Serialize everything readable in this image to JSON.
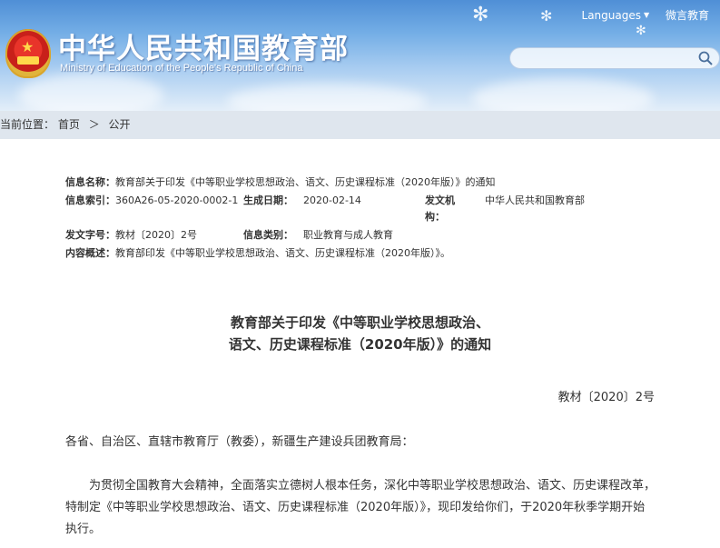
{
  "header": {
    "title": "中华人民共和国教育部",
    "subtitle": "Ministry of Education of the People's Republic of China",
    "links": {
      "languages": "Languages",
      "weibo": "微言教育"
    },
    "search": {
      "placeholder": "",
      "icon": "search-icon"
    }
  },
  "breadcrumb": {
    "prefix": "当前位置：",
    "home": "首页",
    "sep": "＞",
    "current": "公开"
  },
  "meta": {
    "name_label": "信息名称：",
    "name_value": "教育部关于印发《中等职业学校思想政治、语文、历史课程标准（2020年版）》的通知",
    "index_label": "信息索引：",
    "index_value": "360A26-05-2020-0002-1",
    "date_label": "生成日期：",
    "date_value": "2020-02-14",
    "issuer_label_1": "发文机",
    "issuer_label_2": "构：",
    "issuer_value": "中华人民共和国教育部",
    "docno_label": "发文字号：",
    "docno_value": "教材〔2020〕2号",
    "category_label": "信息类别：",
    "category_value": "职业教育与成人教育",
    "summary_label": "内容概述：",
    "summary_value": "教育部印发《中等职业学校思想政治、语文、历史课程标准（2020年版）》。"
  },
  "article": {
    "title_line1": "教育部关于印发《中等职业学校思想政治、",
    "title_line2": "语文、历史课程标准（2020年版）》的通知",
    "doc_number": "教材〔2020〕2号",
    "salutation": "各省、自治区、直辖市教育厅（教委），新疆生产建设兵团教育局：",
    "body_line1": "为贯彻全国教育大会精神，全面落实立德树人根本任务，深化中等职业学校思想政治、语文、历史课程改革，",
    "body_line2": "特制定《中等职业学校思想政治、语文、历史课程标准（2020年版）》，现印发给你们，于2020年秋季学期开始",
    "body_line3": "执行。"
  }
}
